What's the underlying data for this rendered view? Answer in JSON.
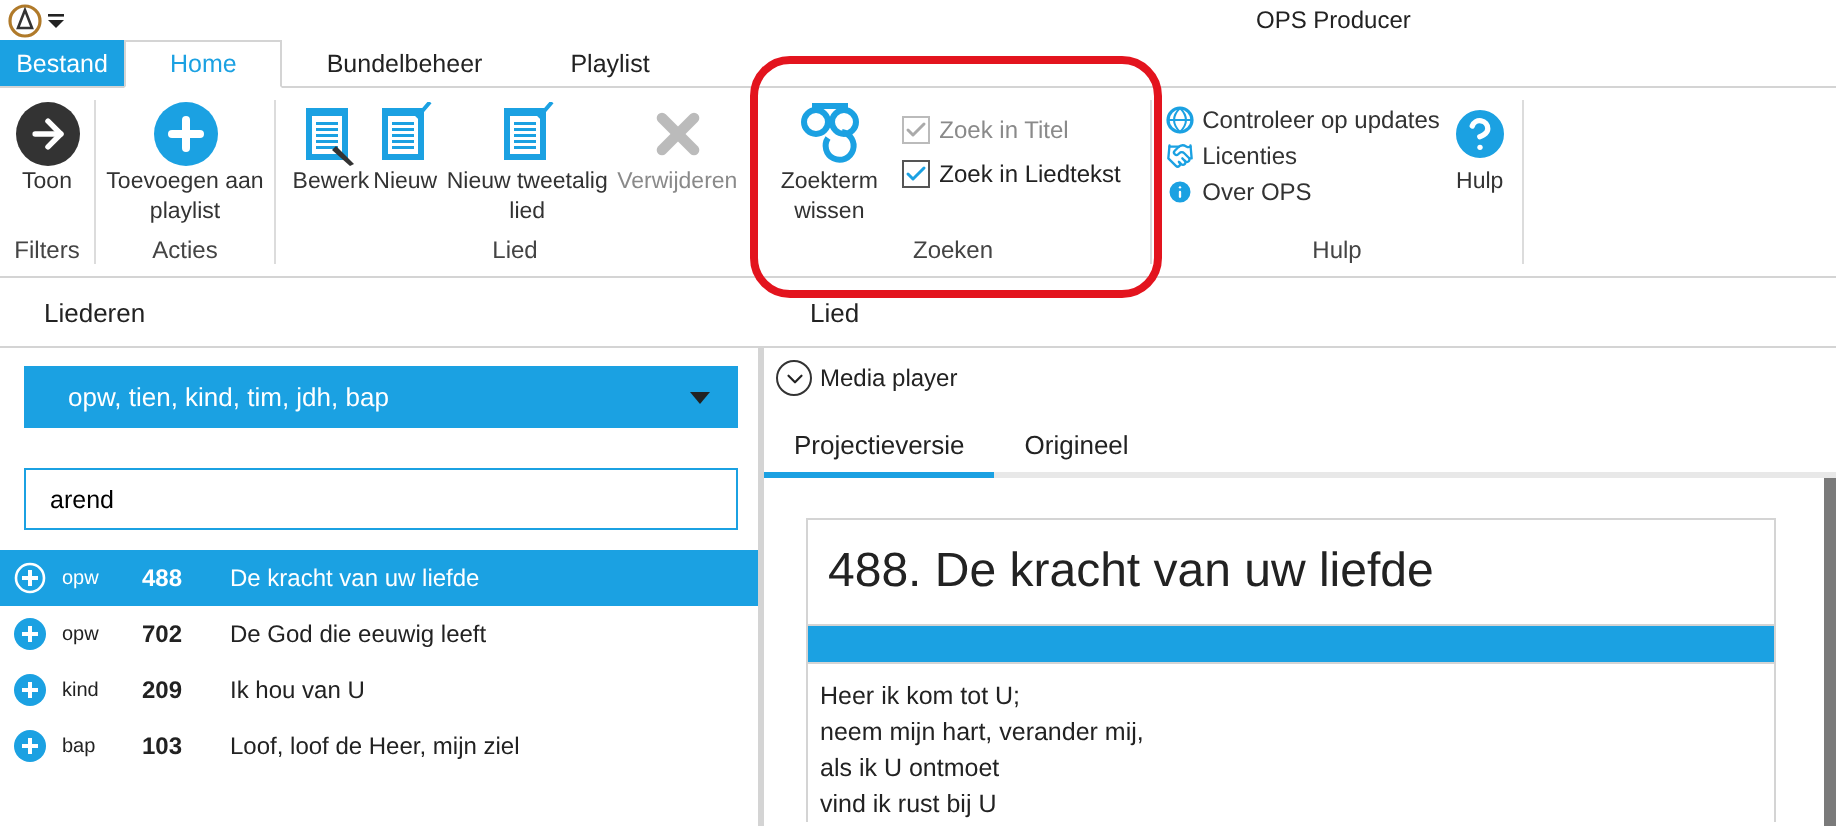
{
  "window": {
    "title": "OPS Producer"
  },
  "ribbon_tabs": [
    {
      "label": "Bestand",
      "kind": "file",
      "selected": false
    },
    {
      "label": "Home",
      "kind": "tab",
      "selected": true
    },
    {
      "label": "Bundelbeheer",
      "kind": "tab",
      "selected": false
    },
    {
      "label": "Playlist",
      "kind": "tab",
      "selected": false
    }
  ],
  "ribbon_groups": [
    {
      "label": "Filters",
      "items": [
        {
          "kind": "large",
          "label": "Toon",
          "disabled": false
        }
      ]
    },
    {
      "label": "Acties",
      "items": [
        {
          "kind": "large",
          "label": "Toevoegen aan playlist",
          "disabled": false
        }
      ]
    },
    {
      "label": "Lied",
      "items": [
        {
          "kind": "large",
          "label": "Bewerk",
          "disabled": false
        },
        {
          "kind": "large",
          "label": "Nieuw",
          "disabled": false
        },
        {
          "kind": "large",
          "label": "Nieuw tweetalig lied",
          "disabled": false
        },
        {
          "kind": "large",
          "label": "Verwijderen",
          "disabled": true
        }
      ]
    },
    {
      "label": "Zoeken",
      "items": [
        {
          "kind": "large",
          "label": "Zoekterm wissen",
          "disabled": false
        },
        {
          "kind": "checkbox",
          "label": "Zoek in Titel",
          "checked": true,
          "disabled": true
        },
        {
          "kind": "checkbox",
          "label": "Zoek in Liedtekst",
          "checked": true,
          "disabled": false
        }
      ]
    },
    {
      "label": "Hulp",
      "items": [
        {
          "kind": "small",
          "label": "Controleer op updates",
          "disabled": false
        },
        {
          "kind": "small",
          "label": "Licenties",
          "disabled": false
        },
        {
          "kind": "small",
          "label": "Over OPS",
          "disabled": false
        },
        {
          "kind": "large",
          "label": "Hulp",
          "disabled": false
        }
      ]
    }
  ],
  "songs_panel": {
    "header": "Liederen",
    "bundle_select": "opw, tien, kind, tim, jdh, bap",
    "search": {
      "value": "arend"
    },
    "rows": [
      {
        "bundle": "opw",
        "number": "488",
        "title": "De kracht van uw liefde",
        "selected": true
      },
      {
        "bundle": "opw",
        "number": "702",
        "title": "De God die eeuwig leeft",
        "selected": false
      },
      {
        "bundle": "kind",
        "number": "209",
        "title": "Ik hou van U",
        "selected": false
      },
      {
        "bundle": "bap",
        "number": "103",
        "title": "Loof, loof de Heer, mijn ziel",
        "selected": false
      }
    ]
  },
  "song_panel": {
    "header": "Lied",
    "media_player": {
      "label": "Media player",
      "expanded": false
    },
    "tabs": [
      {
        "label": "Projectieversie",
        "selected": true
      },
      {
        "label": "Origineel",
        "selected": false
      }
    ],
    "song": {
      "title": "488. De kracht van uw liefde",
      "lines": [
        "Heer ik kom tot U;",
        "neem mijn hart, verander mij,",
        "als ik U ontmoet",
        "vind ik rust bij U"
      ]
    }
  }
}
